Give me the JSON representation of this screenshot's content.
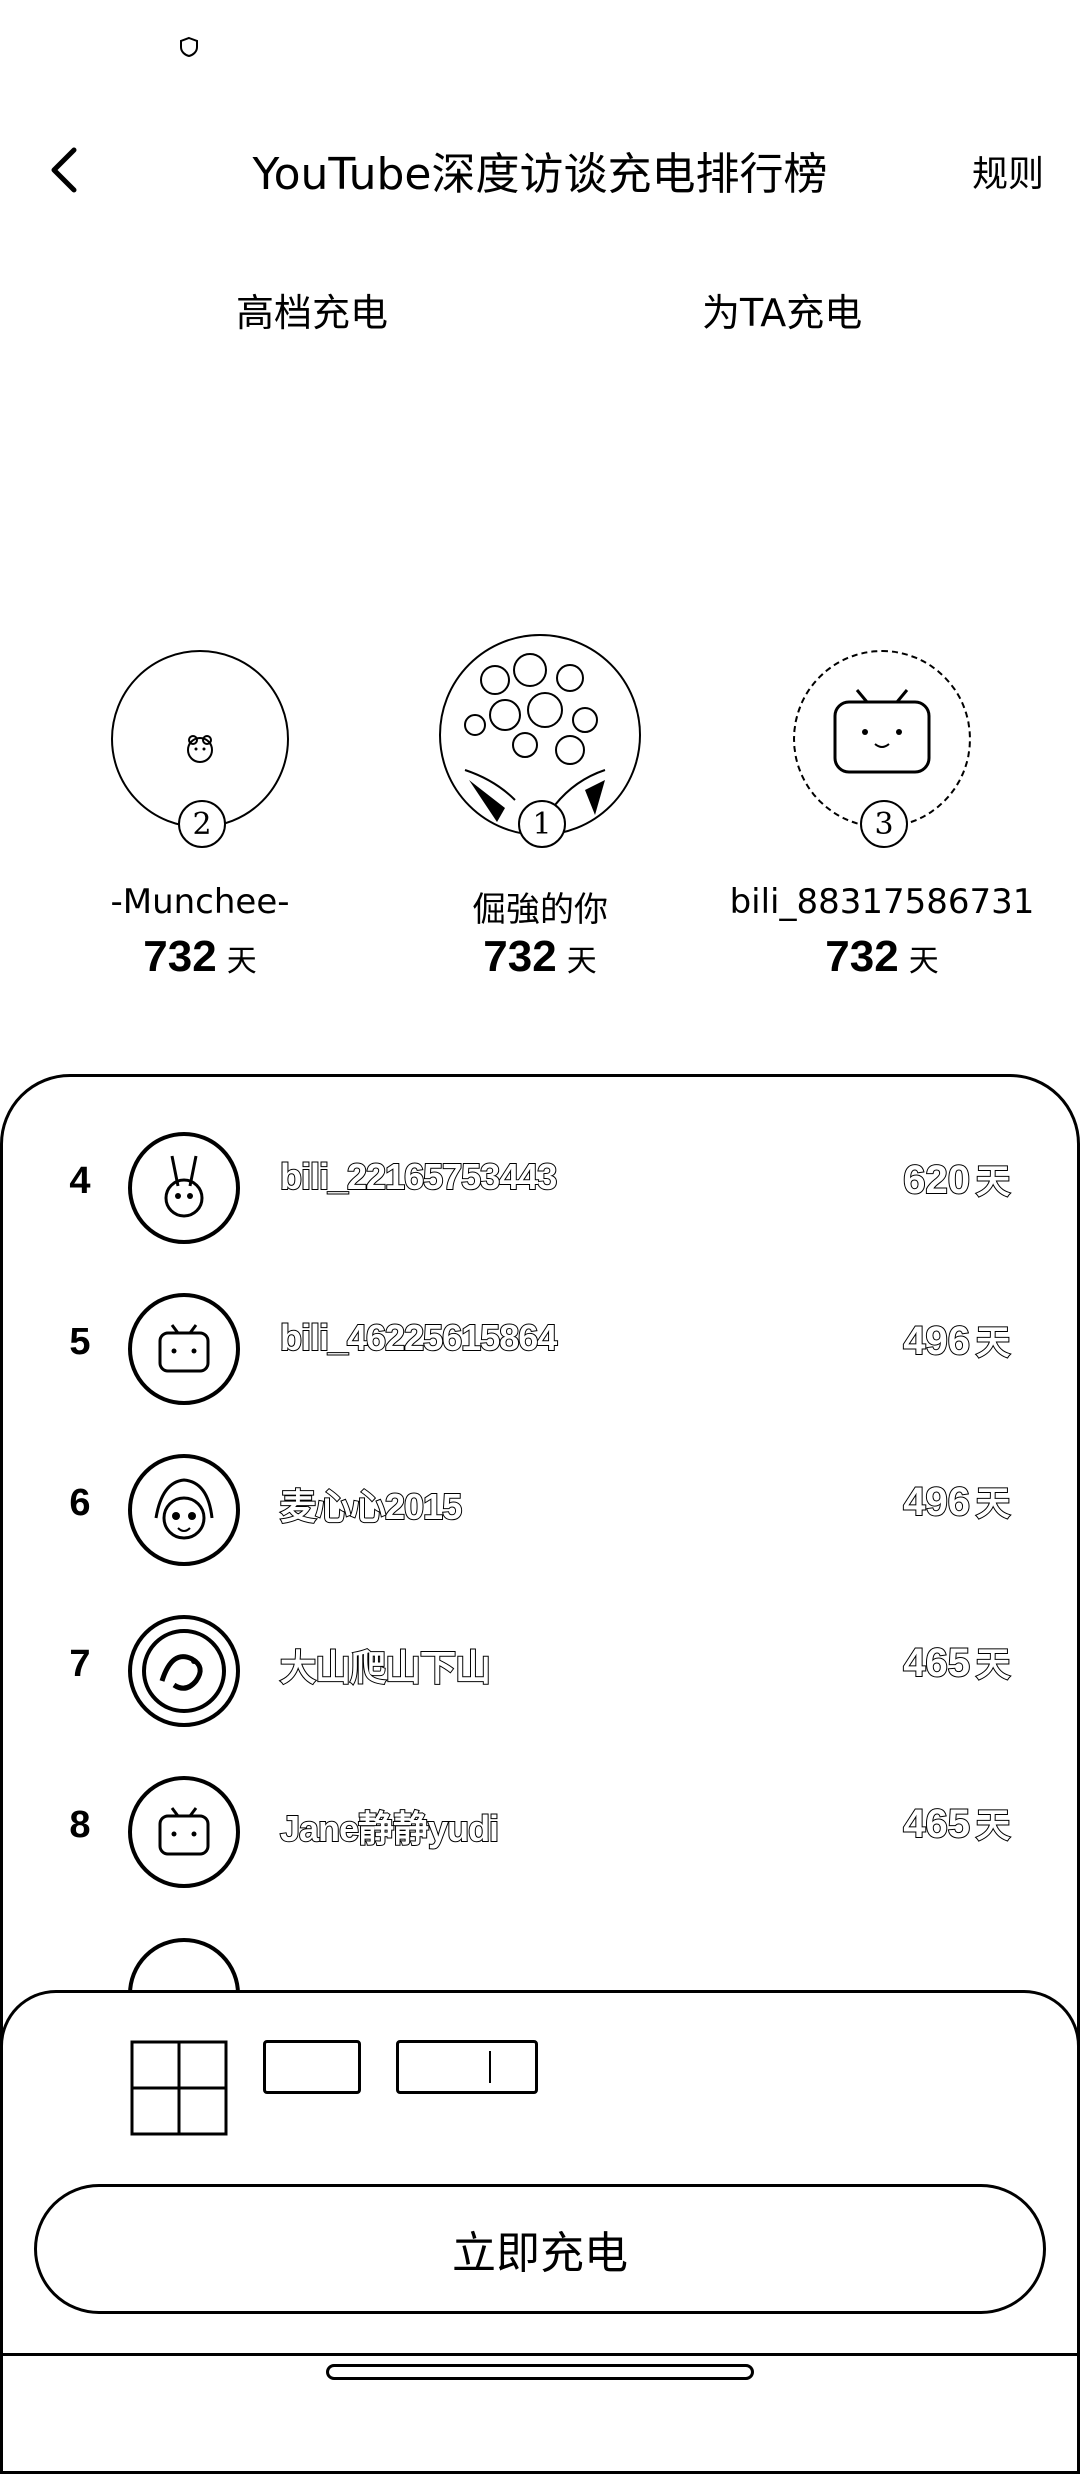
{
  "header": {
    "title": "YouTube深度访谈充电排行榜",
    "rules_label": "规则"
  },
  "tabs": [
    {
      "label": "高档充电",
      "active": true
    },
    {
      "label": "为TA充电",
      "active": false
    }
  ],
  "podium": {
    "second": {
      "rank": "2",
      "name": "-Munchee-",
      "days": "732",
      "unit": "天"
    },
    "first": {
      "rank": "1",
      "name": "倔強的你",
      "days": "732",
      "unit": "天"
    },
    "third": {
      "rank": "3",
      "name": "bili_88317586731",
      "days": "732",
      "unit": "天"
    }
  },
  "ranking": [
    {
      "rank": "4",
      "name": "bili_22165753443",
      "days": "620",
      "unit": "天",
      "avatar": "cartoon-bunny-icon"
    },
    {
      "rank": "5",
      "name": "bili_46225615864",
      "days": "496",
      "unit": "天",
      "avatar": "bilibili-tv-icon"
    },
    {
      "rank": "6",
      "name": "麦心心2015",
      "days": "496",
      "unit": "天",
      "avatar": "anime-girl-icon"
    },
    {
      "rank": "7",
      "name": "大山爬山下山",
      "days": "465",
      "unit": "天",
      "avatar": "dragon-emblem-icon"
    },
    {
      "rank": "8",
      "name": "Jane静静yudi",
      "days": "465",
      "unit": "天",
      "avatar": "bilibili-tv-icon"
    }
  ],
  "bottom": {
    "charge_button": "立即充电"
  }
}
